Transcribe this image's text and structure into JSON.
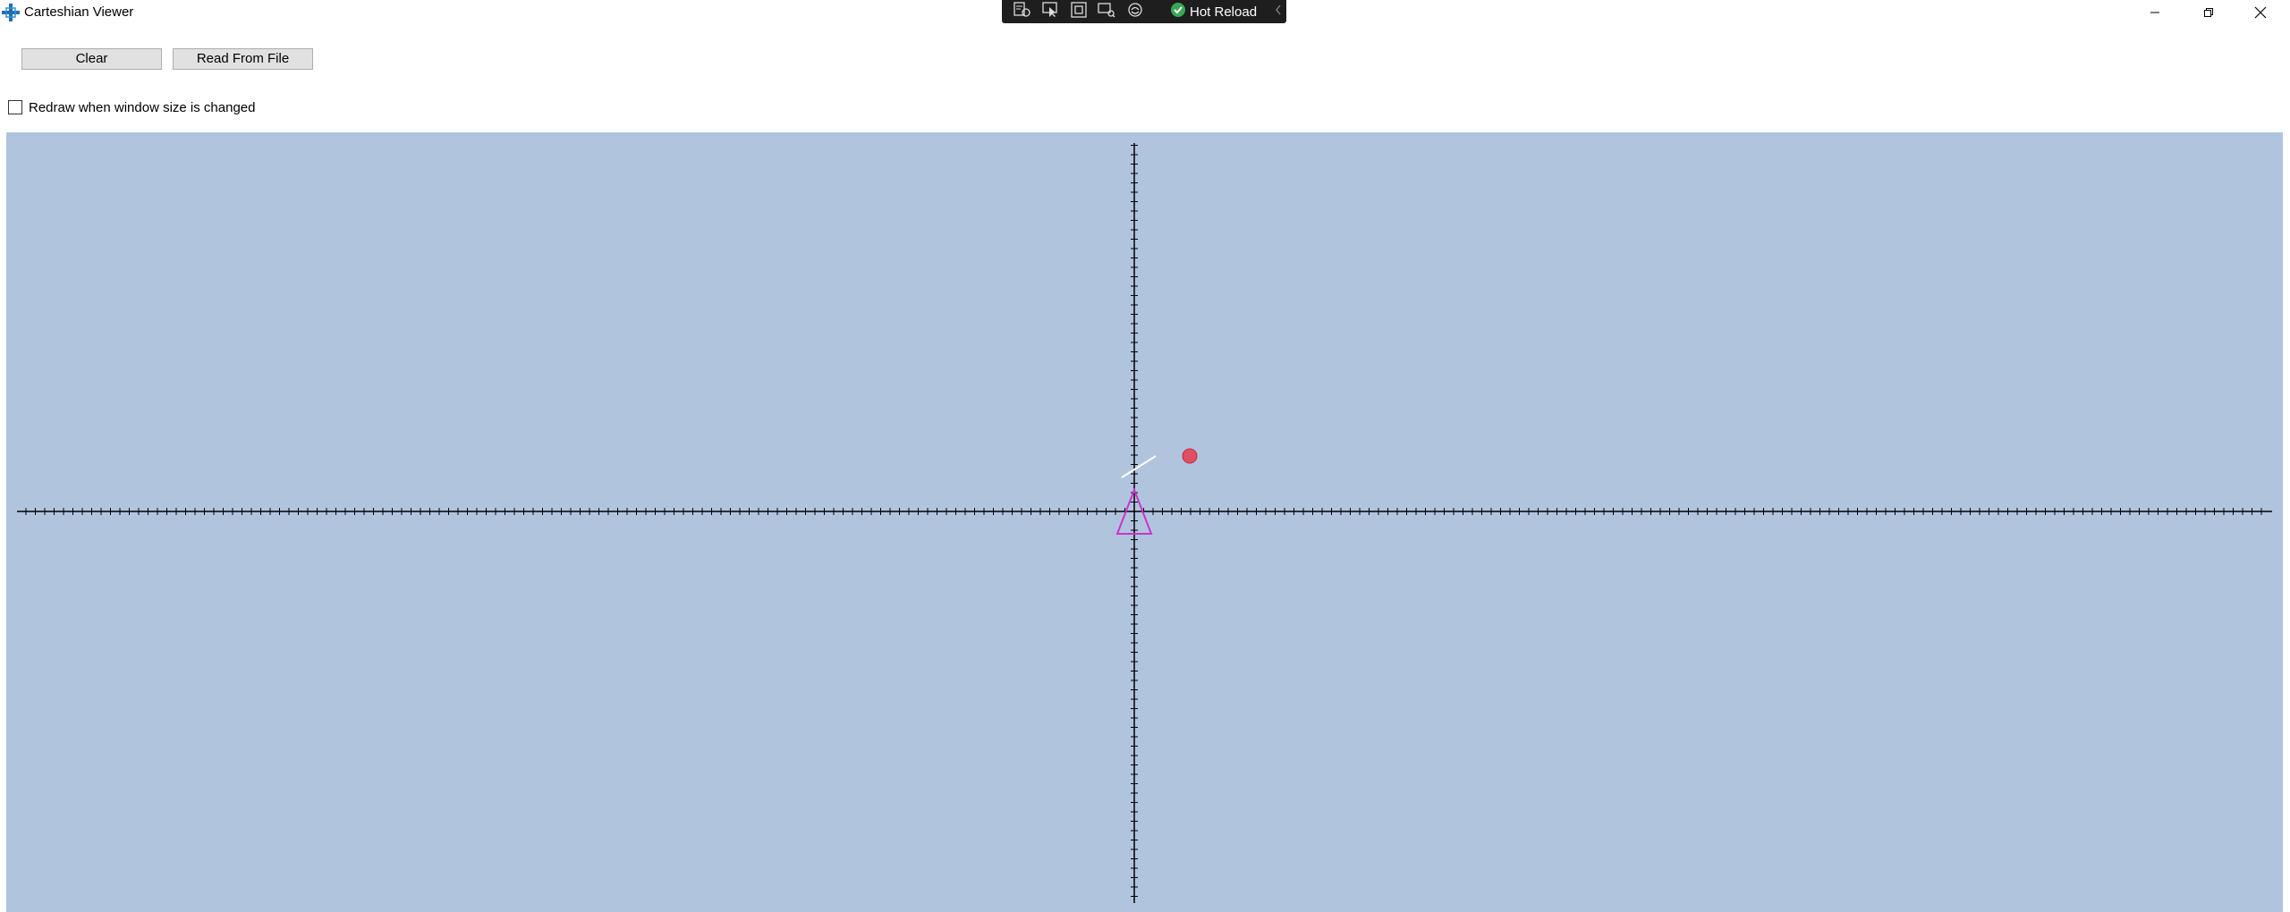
{
  "window": {
    "title": "Carteshian Viewer",
    "icon": "crosshair-app-icon",
    "controls": [
      "minimize-icon",
      "restore-icon",
      "close-icon"
    ]
  },
  "debug_toolbar": {
    "tools": [
      "live-visual-tree-icon",
      "select-element-icon",
      "display-adorners-icon",
      "track-focus-icon",
      "binding-failures-icon"
    ],
    "hot_reload_label": "Hot Reload",
    "hot_reload_status": "checkmark-icon",
    "collapse": "chevron-left-icon"
  },
  "toolbar": {
    "clear_label": "Clear",
    "read_file_label": "Read From File"
  },
  "options": {
    "redraw_label": "Redraw when window size is changed",
    "redraw_checked": false
  },
  "canvas": {
    "background": "#b0c4de",
    "axis_color": "#000000",
    "triangle_color": "#cc33cc",
    "point_color": "#e05060",
    "segment_color": "#ffffff"
  }
}
